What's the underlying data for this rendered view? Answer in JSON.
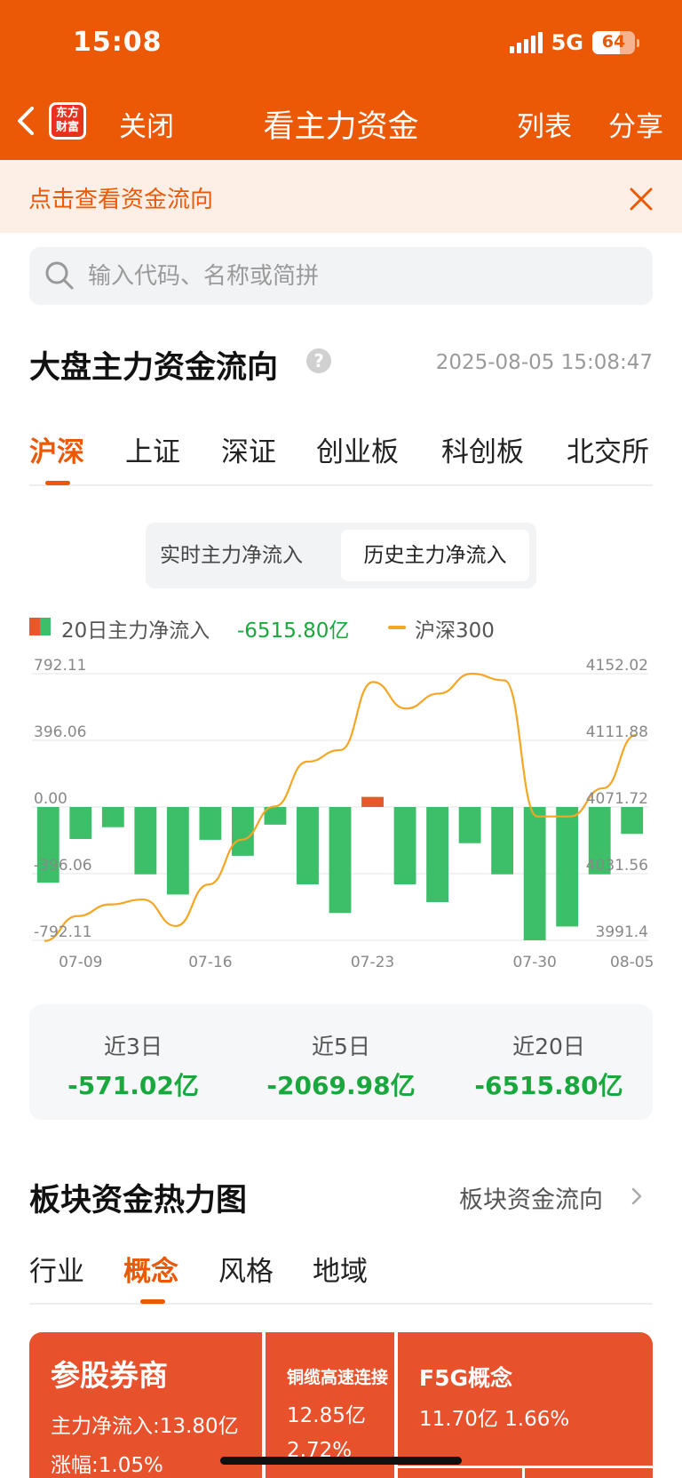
{
  "status": {
    "time": "15:08",
    "network": "5G",
    "battery": "64",
    "battery_level": 0.64
  },
  "nav": {
    "logo_text_1": "东方",
    "logo_text_2": "财富",
    "close": "关闭",
    "title": "看主力资金",
    "list": "列表",
    "share": "分享"
  },
  "banner": {
    "text": "点击查看资金流向"
  },
  "search": {
    "placeholder": "输入代码、名称或简拼"
  },
  "market": {
    "title": "大盘主力资金流向",
    "help": "?",
    "datetime": "2025-08-05 15:08:47",
    "tabs": [
      "沪深",
      "上证",
      "深证",
      "创业板",
      "科创板",
      "北交所"
    ],
    "active_tab": 0,
    "toggle": [
      "实时主力净流入",
      "历史主力净流入"
    ],
    "toggle_active": 1
  },
  "legend": {
    "flow_label": "20日主力净流入",
    "flow_value": "-6515.80亿",
    "index_label": "沪深300"
  },
  "colors": {
    "accent": "#EB5806",
    "inflow": "#E45A2C",
    "outflow": "#3DBE69",
    "line": "#F5A623",
    "green_text": "#18A83E"
  },
  "chart_data": {
    "type": "bar+line",
    "x_labels": [
      "07-09",
      "07-16",
      "07-23",
      "07-30",
      "08-05"
    ],
    "y_left_ticks": [
      "792.11",
      "396.06",
      "0.00",
      "-396.06",
      "-792.11"
    ],
    "y_left_range": [
      -792.11,
      792.11
    ],
    "y_right_ticks": [
      "4152.02",
      "4111.88",
      "4071.72",
      "4031.56",
      "3991.4"
    ],
    "y_right_range": [
      3991.4,
      4152.02
    ],
    "series": [
      {
        "name": "20日主力净流入",
        "type": "bar",
        "unit": "亿",
        "values": [
          -450,
          -190,
          -120,
          -400,
          -520,
          -195,
          -290,
          -105,
          -460,
          -630,
          60,
          -460,
          -565,
          -215,
          -400,
          -792,
          -710,
          -400,
          -160
        ]
      },
      {
        "name": "沪深300",
        "type": "line",
        "values": [
          3991,
          4006,
          4013,
          4016,
          4000,
          4025,
          4052,
          4072,
          4099,
          4106,
          4147,
          4131,
          4140,
          4152,
          4148,
          4066,
          4066,
          4083,
          4115
        ]
      }
    ]
  },
  "stats": [
    {
      "label": "近3日",
      "value": "-571.02亿"
    },
    {
      "label": "近5日",
      "value": "-2069.98亿"
    },
    {
      "label": "近20日",
      "value": "-6515.80亿"
    }
  ],
  "sector": {
    "title": "板块资金热力图",
    "link": "板块资金流向",
    "tabs": [
      "行业",
      "概念",
      "风格",
      "地域"
    ],
    "active_tab": 1,
    "tiles": [
      {
        "name": "参股券商",
        "line1": "主力净流入:13.80亿",
        "line2": "涨幅:1.05%"
      },
      {
        "name": "铜缆高速连接",
        "line1": "12.85亿",
        "line2": "2.72%"
      },
      {
        "name": "F5G概念",
        "line1": "11.70亿  1.66%"
      }
    ]
  }
}
